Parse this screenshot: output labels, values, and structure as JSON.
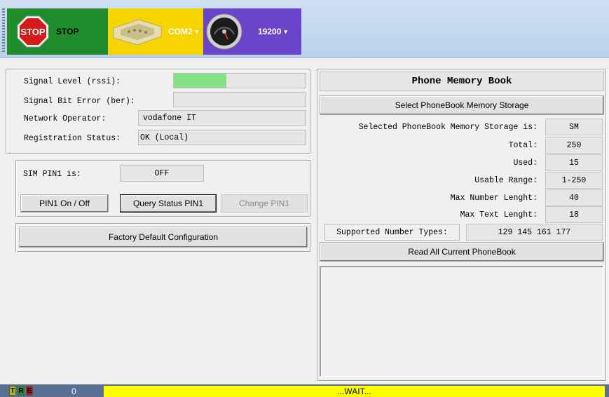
{
  "toolbar": {
    "stop_label": "STOP",
    "stop_sign_text": "STOP",
    "port_label": "COM2",
    "baud_label": "19200",
    "colors": {
      "stop": "#1f8d2c",
      "port": "#f5d400",
      "baud": "#6b44c9"
    }
  },
  "signal": {
    "rssi_label": "Signal Level (rssi):",
    "rssi_level": 0.4,
    "ber_label": "Signal Bit Error (ber):",
    "operator_label": "Network Operator:",
    "operator_value": "vodafone IT",
    "registration_label": "Registration Status:",
    "registration_value": "OK (Local)"
  },
  "pin": {
    "status_label": "SIM PIN1 is:",
    "status_value": "OFF",
    "toggle_button": "PIN1 On / Off",
    "query_button": "Query Status PIN1",
    "change_button": "Change PIN1"
  },
  "factory_button": "Factory Default Configuration",
  "phonebook": {
    "title": "Phone Memory Book",
    "select_button": "Select PhoneBook Memory Storage",
    "rows": [
      {
        "label": "Selected PhoneBook Memory Storage is:",
        "value": "SM"
      },
      {
        "label": "Total:",
        "value": "250"
      },
      {
        "label": "Used:",
        "value": "15"
      },
      {
        "label": "Usable Range:",
        "value": "1-250"
      },
      {
        "label": "Max Number Lenght:",
        "value": "40"
      },
      {
        "label": "Max Text Lenght:",
        "value": "18"
      }
    ],
    "types_label": "Supported Number Types:",
    "types_value": "129 145 161 177",
    "read_button": "Read All Current PhoneBook"
  },
  "statusbar": {
    "led_t": "T",
    "led_r": "R",
    "led_e": "E",
    "count": "0",
    "message": "...WAIT...",
    "colors": {
      "t": "#b8b800",
      "r": "#1d8f1d",
      "e": "#b31414"
    }
  }
}
